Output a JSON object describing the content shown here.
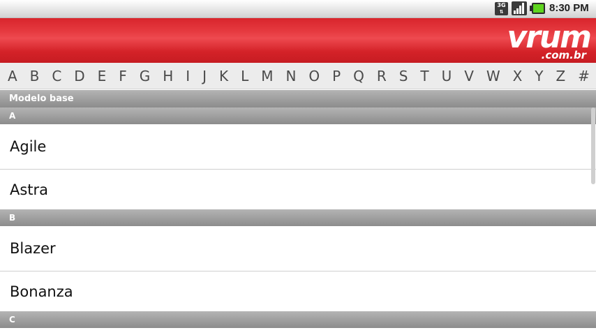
{
  "status_bar": {
    "network": "3G",
    "time": "8:30 PM",
    "icons": [
      "3g-data-icon",
      "signal-icon",
      "battery-icon"
    ]
  },
  "header": {
    "logo_word": "vrum",
    "logo_domain": ".com.br",
    "color": "#e13237"
  },
  "alphabet": [
    "A",
    "B",
    "C",
    "D",
    "E",
    "F",
    "G",
    "H",
    "I",
    "J",
    "K",
    "L",
    "M",
    "N",
    "O",
    "P",
    "Q",
    "R",
    "S",
    "T",
    "U",
    "V",
    "W",
    "X",
    "Y",
    "Z",
    "#"
  ],
  "list": {
    "title": "Modelo base",
    "sections": [
      {
        "letter": "A",
        "items": [
          "Agile",
          "Astra"
        ]
      },
      {
        "letter": "B",
        "items": [
          "Blazer",
          "Bonanza"
        ]
      },
      {
        "letter": "C",
        "items": []
      }
    ]
  }
}
